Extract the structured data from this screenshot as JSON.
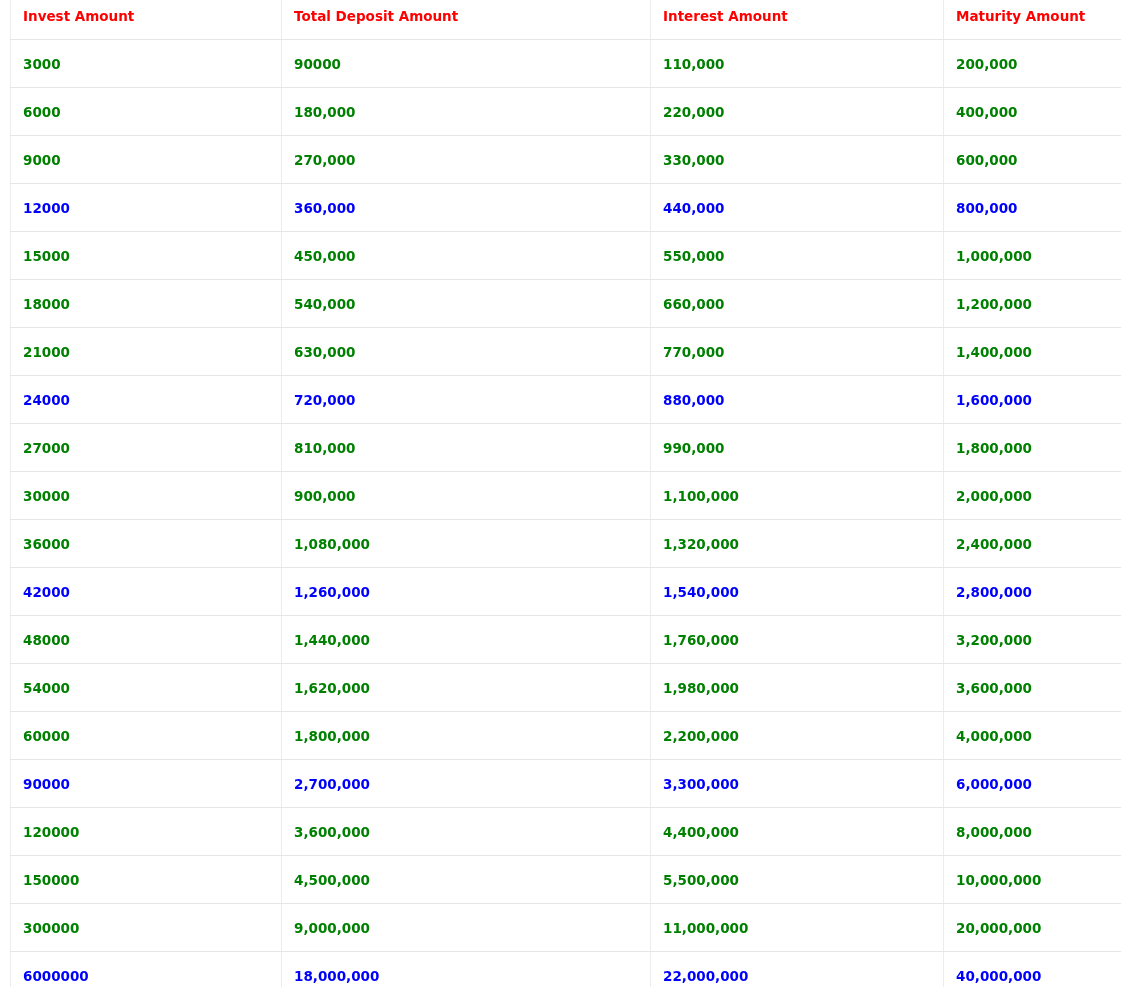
{
  "table": {
    "columns": [
      "Invest Amount",
      "Total Deposit Amount",
      "Interest Amount",
      "Maturity Amount"
    ],
    "rows": [
      {
        "color": "#008000",
        "cells": [
          "3000",
          "90000",
          "110,000",
          "200,000"
        ]
      },
      {
        "color": "#008000",
        "cells": [
          "6000",
          "180,000",
          "220,000",
          "400,000"
        ]
      },
      {
        "color": "#008000",
        "cells": [
          "9000",
          "270,000",
          "330,000",
          "600,000"
        ]
      },
      {
        "color": "#0000ff",
        "cells": [
          "12000",
          "360,000",
          "440,000",
          "800,000"
        ]
      },
      {
        "color": "#008000",
        "cells": [
          "15000",
          "450,000",
          "550,000",
          "1,000,000"
        ]
      },
      {
        "color": "#008000",
        "cells": [
          "18000",
          "540,000",
          "660,000",
          "1,200,000"
        ]
      },
      {
        "color": "#008000",
        "cells": [
          "21000",
          "630,000",
          "770,000",
          "1,400,000"
        ]
      },
      {
        "color": "#0000ff",
        "cells": [
          "24000",
          "720,000",
          "880,000",
          "1,600,000"
        ]
      },
      {
        "color": "#008000",
        "cells": [
          "27000",
          "810,000",
          "990,000",
          "1,800,000"
        ]
      },
      {
        "color": "#008000",
        "cells": [
          "30000",
          "900,000",
          "1,100,000",
          "2,000,000"
        ]
      },
      {
        "color": "#008000",
        "cells": [
          "36000",
          "1,080,000",
          "1,320,000",
          "2,400,000"
        ]
      },
      {
        "color": "#0000ff",
        "cells": [
          "42000",
          "1,260,000",
          "1,540,000",
          "2,800,000"
        ]
      },
      {
        "color": "#008000",
        "cells": [
          "48000",
          "1,440,000",
          "1,760,000",
          "3,200,000"
        ]
      },
      {
        "color": "#008000",
        "cells": [
          "54000",
          "1,620,000",
          "1,980,000",
          "3,600,000"
        ]
      },
      {
        "color": "#008000",
        "cells": [
          "60000",
          "1,800,000",
          "2,200,000",
          "4,000,000"
        ]
      },
      {
        "color": "#0000ff",
        "cells": [
          "90000",
          "2,700,000",
          "3,300,000",
          "6,000,000"
        ]
      },
      {
        "color": "#008000",
        "cells": [
          "120000",
          "3,600,000",
          "4,400,000",
          "8,000,000"
        ]
      },
      {
        "color": "#008000",
        "cells": [
          "150000",
          "4,500,000",
          "5,500,000",
          "10,000,000"
        ]
      },
      {
        "color": "#008000",
        "cells": [
          "300000",
          "9,000,000",
          "11,000,000",
          "20,000,000"
        ]
      },
      {
        "color": "#0000ff",
        "cells": [
          "6000000",
          "18,000,000",
          "22,000,000",
          "40,000,000"
        ]
      }
    ]
  }
}
